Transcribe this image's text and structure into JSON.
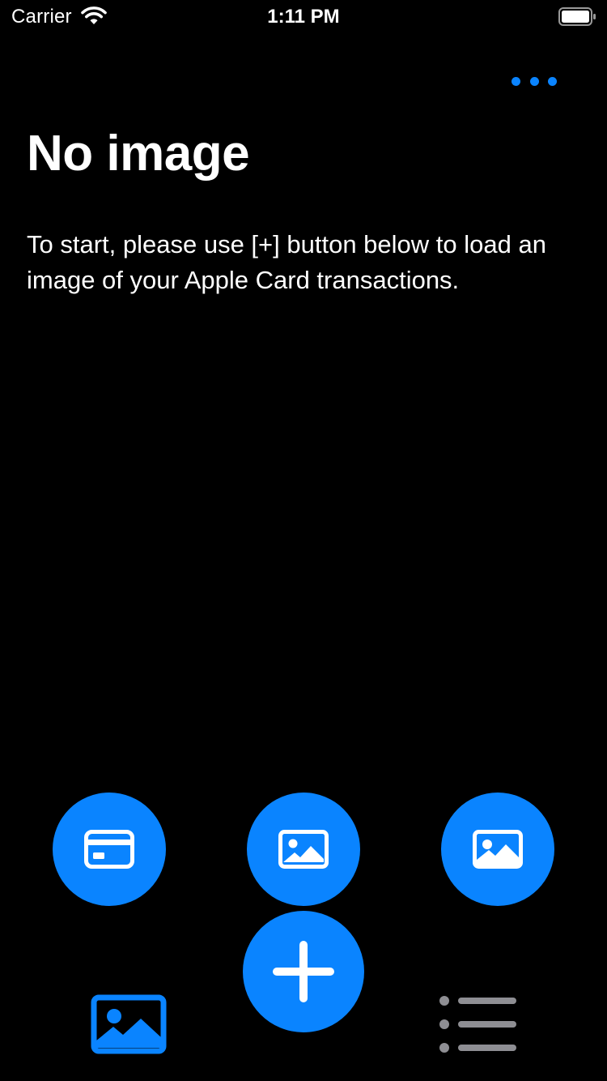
{
  "status_bar": {
    "carrier": "Carrier",
    "time": "1:11 PM"
  },
  "header": {
    "more_icon": "ellipsis-icon"
  },
  "main": {
    "title": "No image",
    "instructions": "To start, please use [+] button below to load an image of your Apple Card transactions."
  },
  "actions": [
    {
      "icon": "credit-card-icon"
    },
    {
      "icon": "photo-icon"
    },
    {
      "icon": "photo-filled-icon"
    },
    {
      "icon": "plus-icon"
    }
  ],
  "tab_bar": {
    "items": [
      {
        "icon": "photo-icon",
        "selected": true
      },
      {
        "icon": "list-icon",
        "selected": false
      }
    ]
  },
  "colors": {
    "accent": "#0a84ff",
    "background": "#000000",
    "text": "#ffffff",
    "inactive": "#8e8e93"
  }
}
